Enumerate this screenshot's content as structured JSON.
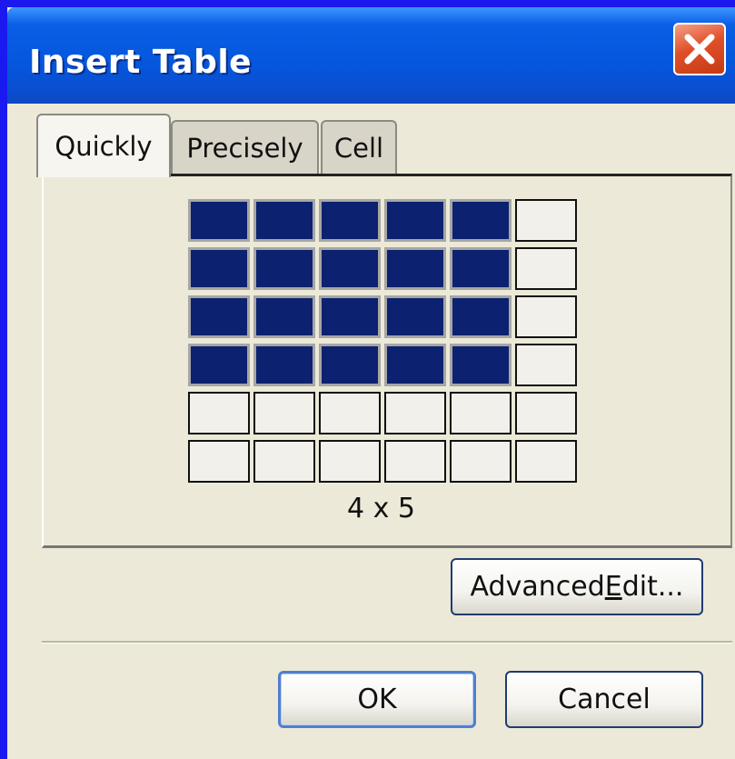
{
  "window": {
    "title": "Insert Table"
  },
  "tabs": [
    {
      "label": "Quickly",
      "selected": true
    },
    {
      "label": "Precisely",
      "selected": false
    },
    {
      "label": "Cell",
      "selected": false
    }
  ],
  "quick_grid": {
    "columns": 6,
    "rows": 6,
    "selected_rows": 4,
    "selected_columns": 5,
    "size_label": "4 x 5"
  },
  "buttons": {
    "advanced_edit_prefix": "Advanced ",
    "advanced_edit_mnemonic": "E",
    "advanced_edit_suffix": "dit...",
    "ok": "OK",
    "cancel": "Cancel"
  },
  "colors": {
    "title_bar": "#0556dc",
    "selected_cell": "#0c2270",
    "dialog_background": "#ece9d8",
    "close_button": "#e0502a"
  },
  "icons": {
    "close": "close-icon"
  }
}
